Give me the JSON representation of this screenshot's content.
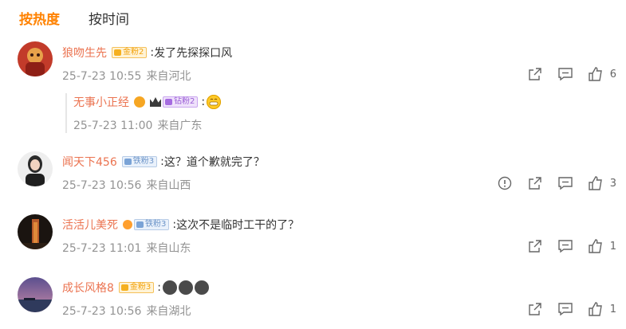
{
  "tabs": [
    {
      "label": "按热度"
    },
    {
      "label": "按时间"
    }
  ],
  "comments": [
    {
      "user": "狼吻生先",
      "badge": "金粉2",
      "text": "发了先探探口风",
      "date": "25-7-23 10:55",
      "location": "来自河北",
      "likes": "6",
      "reply": {
        "user": "无事小正经",
        "badge": "钻粉2",
        "date": "25-7-23 11:00",
        "location": "来自广东"
      }
    },
    {
      "user": "闻天下456",
      "badge": "铁粉3",
      "text": "这？道个歉就完了？",
      "date": "25-7-23 10:56",
      "location": "来自山西",
      "likes": "3"
    },
    {
      "user": "活活儿美死",
      "badge": "铁粉3",
      "text": "这次不是临时工干的了？",
      "date": "25-7-23 11:01",
      "location": "来自山东",
      "likes": "1"
    },
    {
      "user": "成长风格8",
      "badge": "金粉3",
      "text": "",
      "date": "25-7-23 10:56",
      "location": "来自湖北",
      "likes": "1"
    }
  ],
  "colors": {
    "accent": "#ff8200",
    "username": "#eb7350",
    "meta": "#939393"
  },
  "icons": [
    "report-icon",
    "forward-icon",
    "comment-icon",
    "like-icon",
    "smile-emoji",
    "verified-icon",
    "crown-icon"
  ]
}
